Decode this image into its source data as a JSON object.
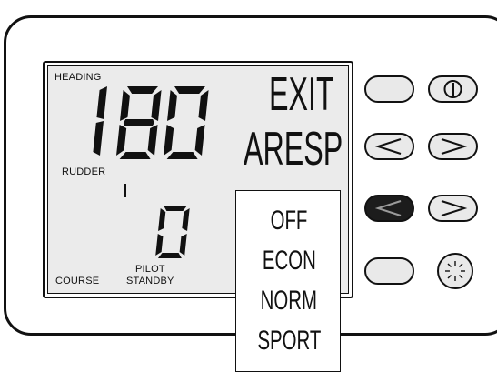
{
  "display": {
    "heading_label": "HEADING",
    "heading_value": "180",
    "rudder_label": "RUDDER",
    "course_label": "COURSE",
    "course_value": "0",
    "pilot_label": "PILOT",
    "standby_label": "STANDBY",
    "exit_label": "EXIT",
    "aresp_label": "ARESP"
  },
  "menu": {
    "items": [
      "OFF",
      "ECON",
      "NORM",
      "SPORT"
    ]
  },
  "buttons": {
    "row1": [
      "blank-button",
      "power-icon"
    ],
    "row2": [
      "chevron-left-icon",
      "chevron-right-icon"
    ],
    "row3": [
      "chevron-left-icon",
      "chevron-right-icon"
    ],
    "row4": [
      "blank-button",
      "brightness-icon"
    ],
    "pressed_color": "#1c1c1c",
    "button_color": "#e9e9e9"
  }
}
